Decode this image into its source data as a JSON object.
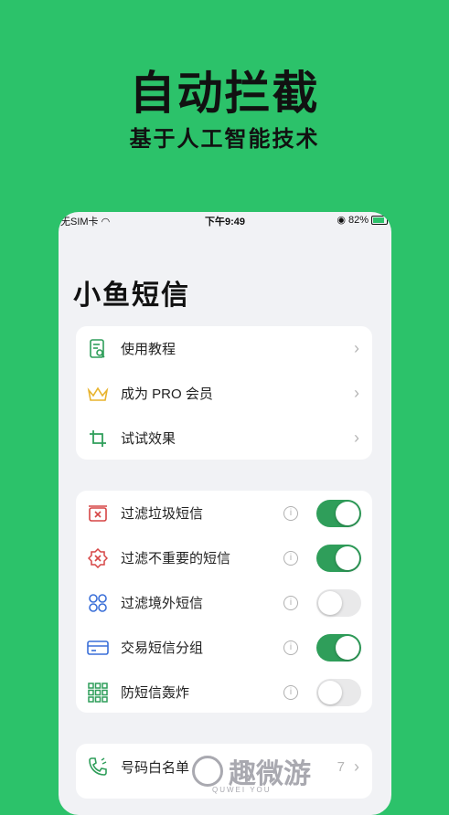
{
  "hero": {
    "title": "自动拦截",
    "subtitle": "基于人工智能技术"
  },
  "status": {
    "carrier": "无SIM卡",
    "time": "下午9:49",
    "battery": "82%"
  },
  "app": {
    "title": "小鱼短信"
  },
  "menu": [
    {
      "label": "使用教程",
      "icon": "document-search-icon"
    },
    {
      "label": "成为 PRO 会员",
      "icon": "crown-icon"
    },
    {
      "label": "试试效果",
      "icon": "crop-icon"
    }
  ],
  "filters": [
    {
      "label": "过滤垃圾短信",
      "on": true,
      "icon": "spam-box-icon"
    },
    {
      "label": "过滤不重要的短信",
      "on": true,
      "icon": "x-badge-icon"
    },
    {
      "label": "过滤境外短信",
      "on": false,
      "icon": "grid-dots-icon"
    },
    {
      "label": "交易短信分组",
      "on": true,
      "icon": "card-icon"
    },
    {
      "label": "防短信轰炸",
      "on": false,
      "icon": "grid-square-icon"
    }
  ],
  "bottom": {
    "label": "号码白名单",
    "count": "7"
  },
  "watermark": {
    "text": "趣微游",
    "sub": "QUWEI YOU"
  },
  "colors": {
    "bg": "#2cc26a",
    "toggle_on": "#2f9e5a"
  }
}
